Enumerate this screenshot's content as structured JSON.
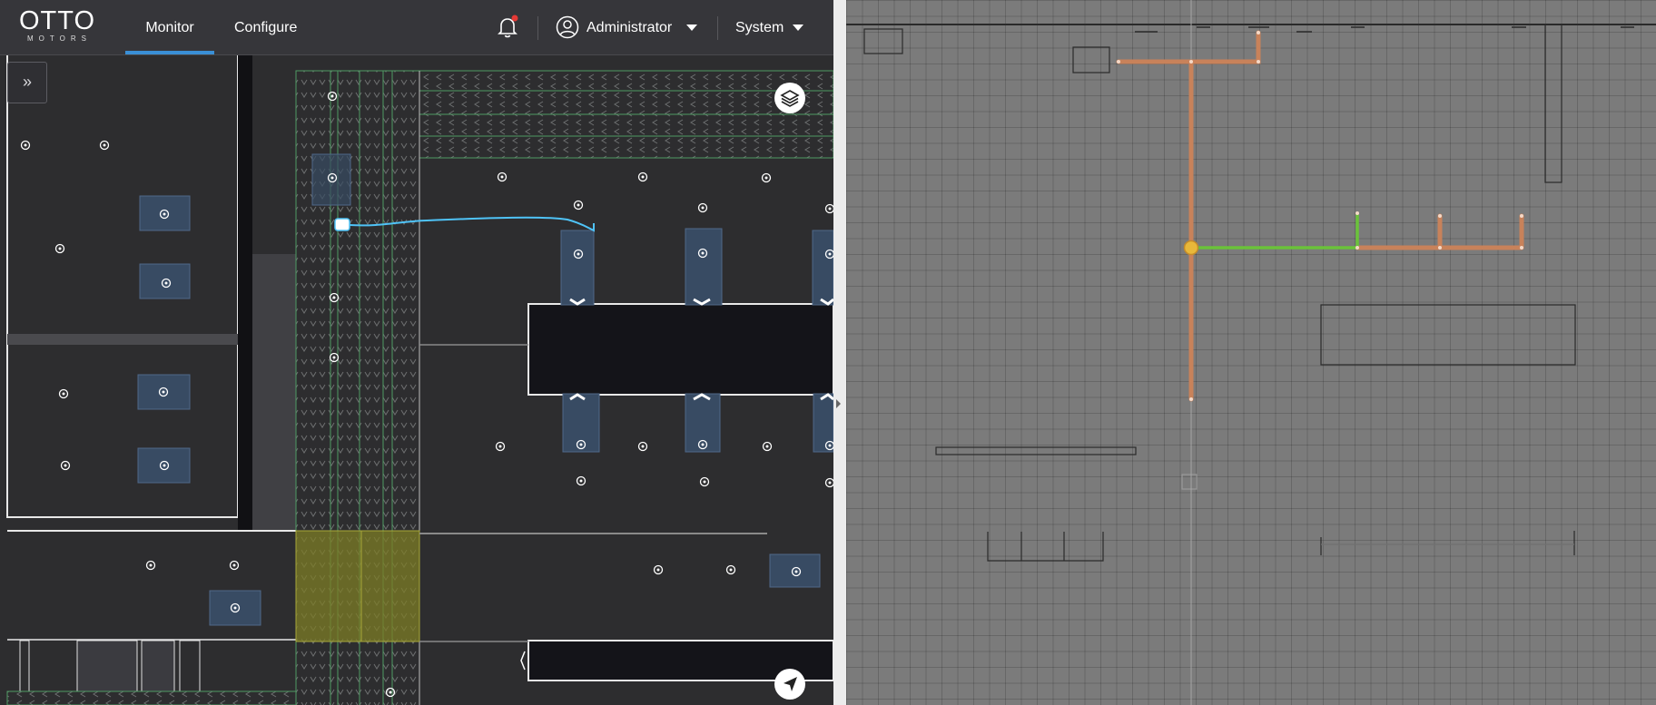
{
  "nav": {
    "logo_main": "OTTO",
    "logo_sub": "MOTORS",
    "tabs": [
      {
        "label": "Monitor",
        "active": true
      },
      {
        "label": "Configure",
        "active": false
      }
    ],
    "user_label": "Administrator",
    "system_label": "System",
    "notification_dot": true
  },
  "colors": {
    "accent": "#3a8fd6",
    "notification": "#e53935",
    "robot_path": "#4fc3f7",
    "zone_fill": "#8a8a2a",
    "route_orange": "#c8825a",
    "route_green": "#6ac23a",
    "station_box": "#384b63"
  },
  "icons": {
    "expand": "double-chevron-right-icon",
    "layers": "layers-icon",
    "locate": "navigation-arrow-icon",
    "bell": "bell-icon",
    "user": "user-circle-icon",
    "dropdown": "caret-down-icon"
  }
}
